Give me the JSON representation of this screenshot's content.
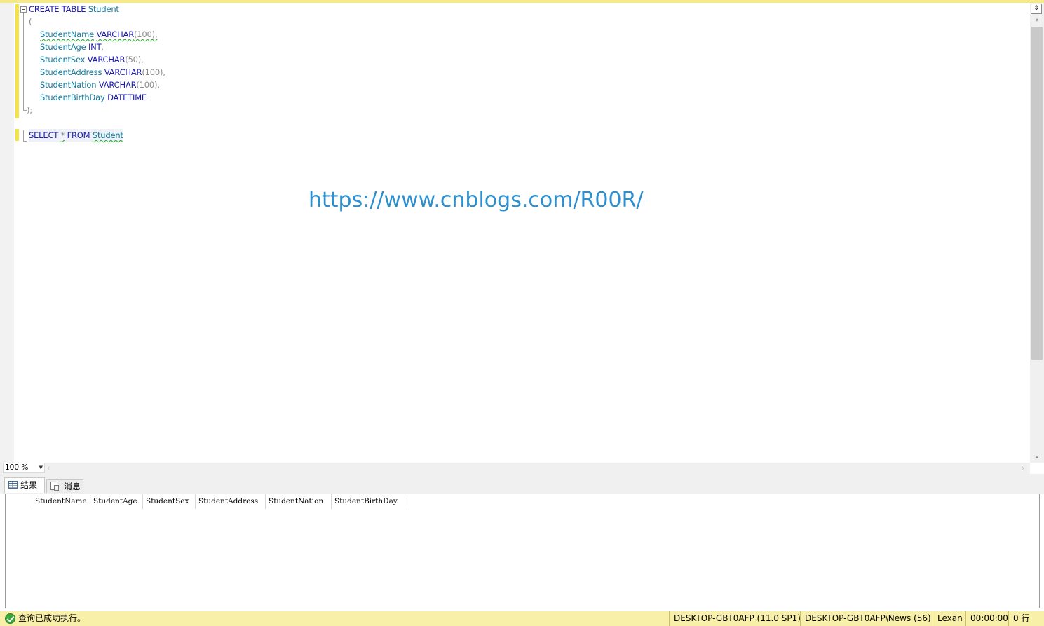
{
  "editor": {
    "create_kw": "CREATE TABLE",
    "table_name": "Student",
    "open_paren": "(",
    "columns": [
      {
        "name": "StudentName",
        "type": "VARCHAR",
        "args": "(100),"
      },
      {
        "name": "StudentAge",
        "type": "INT",
        "args": ","
      },
      {
        "name": "StudentSex",
        "type": "VARCHAR",
        "args": "(50),"
      },
      {
        "name": "StudentAddress",
        "type": "VARCHAR",
        "args": "(100),"
      },
      {
        "name": "StudentNation",
        "type": "VARCHAR",
        "args": "(100),"
      },
      {
        "name": "StudentBirthDay",
        "type": "DATETIME",
        "args": ""
      }
    ],
    "close_paren": ");",
    "select_kw": "SELECT",
    "star": "*",
    "from_kw": "FROM",
    "select_table": "Student"
  },
  "watermark": "https://www.cnblogs.com/R00R/",
  "zoom": "100 %",
  "tabs": {
    "results": "结果",
    "messages": "消息"
  },
  "grid": {
    "columns": [
      "StudentName",
      "StudentAge",
      "StudentSex",
      "StudentAddress",
      "StudentNation",
      "StudentBirthDay"
    ]
  },
  "status": {
    "message": "查询已成功执行。",
    "server": "DESKTOP-GBT0AFP (11.0 SP1)",
    "connection": "DESKTOP-GBT0AFP\\News (56)",
    "database": "Lexan",
    "elapsed": "00:00:00",
    "rows": "0 行"
  },
  "colors": {
    "keyword": "#1b1bb0",
    "identifier": "#127a9a",
    "status_bar": "#f8efa8",
    "change_marker": "#f4e24a"
  }
}
